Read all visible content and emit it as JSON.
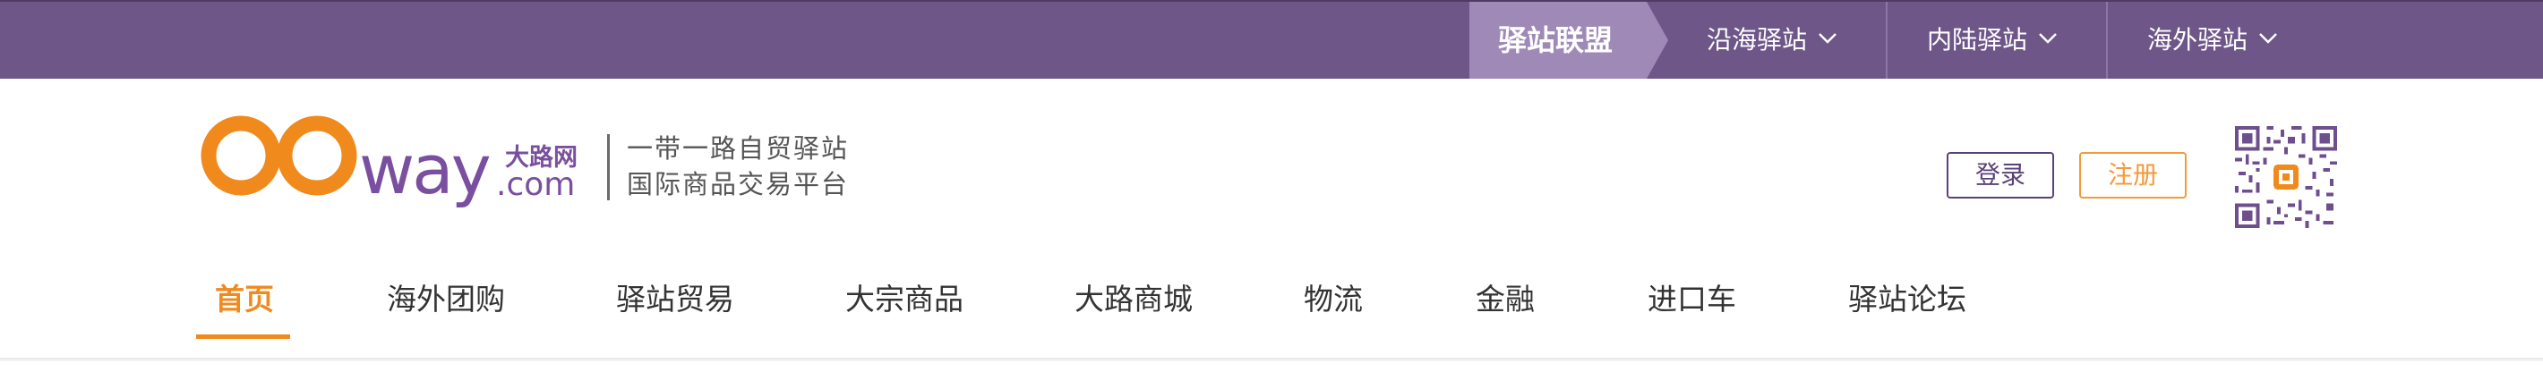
{
  "topbar": {
    "alliance_label": "驿站联盟",
    "menus": [
      {
        "label": "沿海驿站"
      },
      {
        "label": "内陆驿站"
      },
      {
        "label": "海外驿站"
      }
    ]
  },
  "brand": {
    "logo_text": "OOway",
    "logo_cn": "大路网",
    "logo_domain": ".com",
    "slogan_line1": "一带一路自贸驿站",
    "slogan_line2": "国际商品交易平台"
  },
  "auth": {
    "login_label": "登录",
    "register_label": "注册"
  },
  "nav": {
    "items": [
      {
        "label": "首页"
      },
      {
        "label": "海外团购"
      },
      {
        "label": "驿站贸易"
      },
      {
        "label": "大宗商品"
      },
      {
        "label": "大路商城"
      },
      {
        "label": "物流"
      },
      {
        "label": "金融"
      },
      {
        "label": "进口车"
      },
      {
        "label": "驿站论坛"
      }
    ]
  },
  "colors": {
    "topbar": "#6e5689",
    "alliance": "#9f89b7",
    "accent_orange": "#ef8a1f",
    "brand_purple": "#7a4fa0"
  }
}
